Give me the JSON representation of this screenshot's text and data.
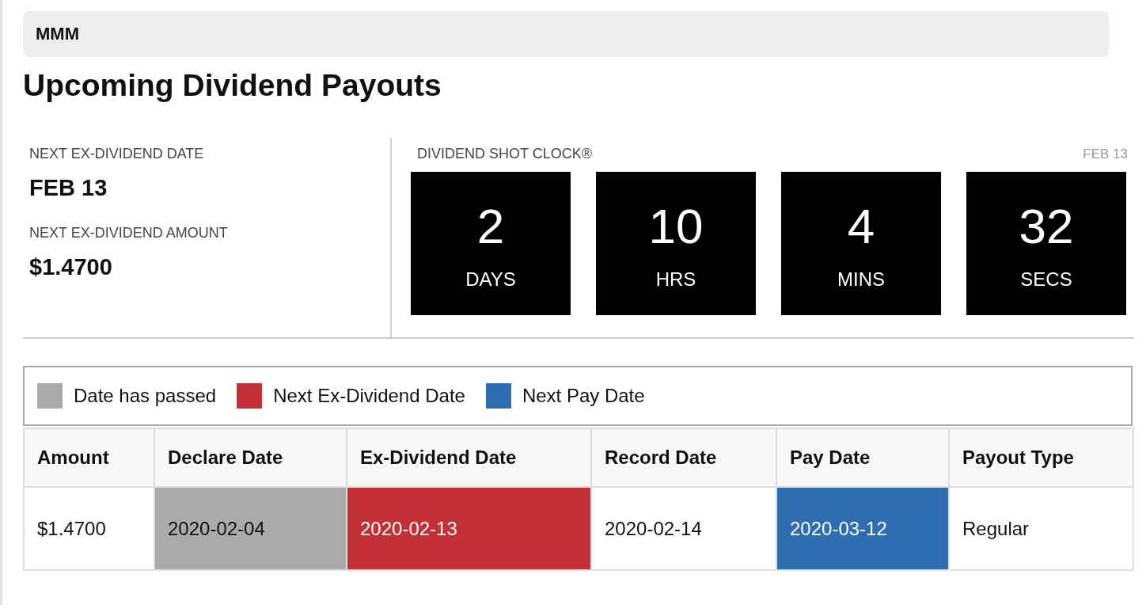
{
  "ticker": "MMM",
  "title": "Upcoming Dividend Payouts",
  "summary": [
    {
      "label": "NEXT EX-DIVIDEND DATE",
      "value": "FEB 13"
    },
    {
      "label": "NEXT EX-DIVIDEND AMOUNT",
      "value": "$1.4700"
    }
  ],
  "shot_clock": {
    "label": "DIVIDEND SHOT CLOCK®",
    "date": "FEB 13",
    "units": [
      {
        "value": "2",
        "unit": "DAYS"
      },
      {
        "value": "10",
        "unit": "HRS"
      },
      {
        "value": "4",
        "unit": "MINS"
      },
      {
        "value": "32",
        "unit": "SECS"
      }
    ]
  },
  "legend": [
    {
      "label": "Date has passed",
      "color": "#aaaaaa"
    },
    {
      "label": "Next Ex-Dividend Date",
      "color": "#c33035"
    },
    {
      "label": "Next Pay Date",
      "color": "#2e6db0"
    }
  ],
  "table": {
    "columns": [
      "Amount",
      "Declare Date",
      "Ex-Dividend Date",
      "Record Date",
      "Pay Date",
      "Payout Type"
    ],
    "rows": [
      [
        {
          "text": "$1.4700"
        },
        {
          "text": "2020-02-04",
          "color": "#aaaaaa"
        },
        {
          "text": "2020-02-13",
          "color": "#c33035"
        },
        {
          "text": "2020-02-14"
        },
        {
          "text": "2020-03-12",
          "color": "#2e6db0"
        },
        {
          "text": "Regular"
        }
      ]
    ]
  }
}
